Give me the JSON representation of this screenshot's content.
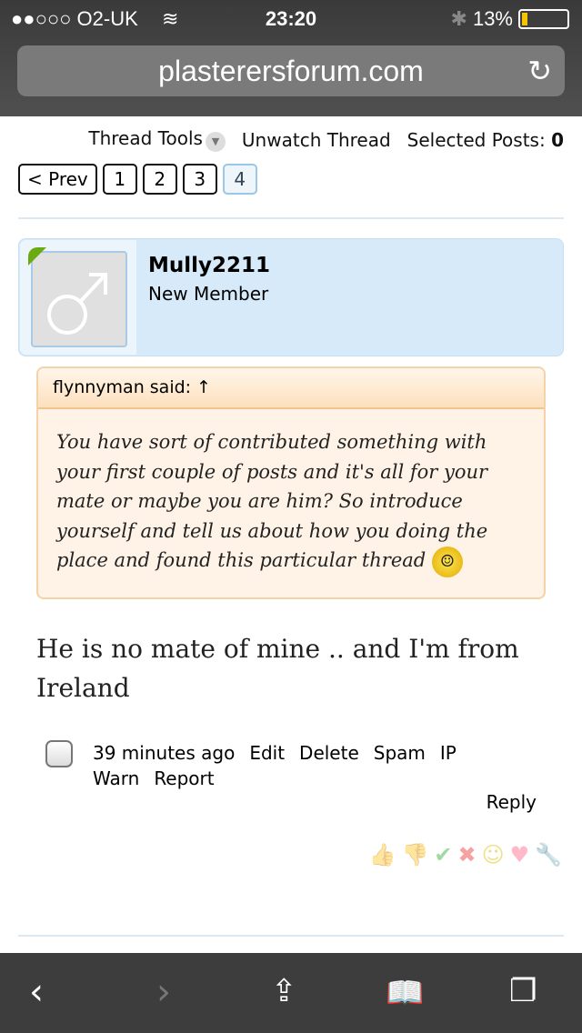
{
  "status": {
    "carrier": "●●○○○ O2-UK",
    "time": "23:20",
    "battery": "13%",
    "battery_level": 0.13
  },
  "browser": {
    "url": "plasterersforum.com"
  },
  "toolbar": {
    "thread_tools": "Thread Tools",
    "unwatch": "Unwatch Thread",
    "selected": "Selected Posts:",
    "selected_count": "0"
  },
  "pager": {
    "prev": "< Prev",
    "pages": [
      "1",
      "2",
      "3",
      "4"
    ],
    "current": "4"
  },
  "post": {
    "username": "Mully2211",
    "user_title": "New Member",
    "quote": {
      "author": "flynnyman said: ↑",
      "text": "You have sort of contributed something with your first couple of posts and it's all for your mate or maybe you are him? So introduce yourself and tell us about how you doing the place and found this particular thread"
    },
    "message": "He is no mate of mine .. and I'm from Ireland",
    "time": "39 minutes ago",
    "actions": [
      "Edit",
      "Delete",
      "Spam",
      "IP",
      "Warn",
      "Report"
    ],
    "reply": "Reply",
    "reactions": [
      "like",
      "dislike",
      "agree",
      "disagree",
      "funny",
      "love",
      "useful"
    ]
  }
}
